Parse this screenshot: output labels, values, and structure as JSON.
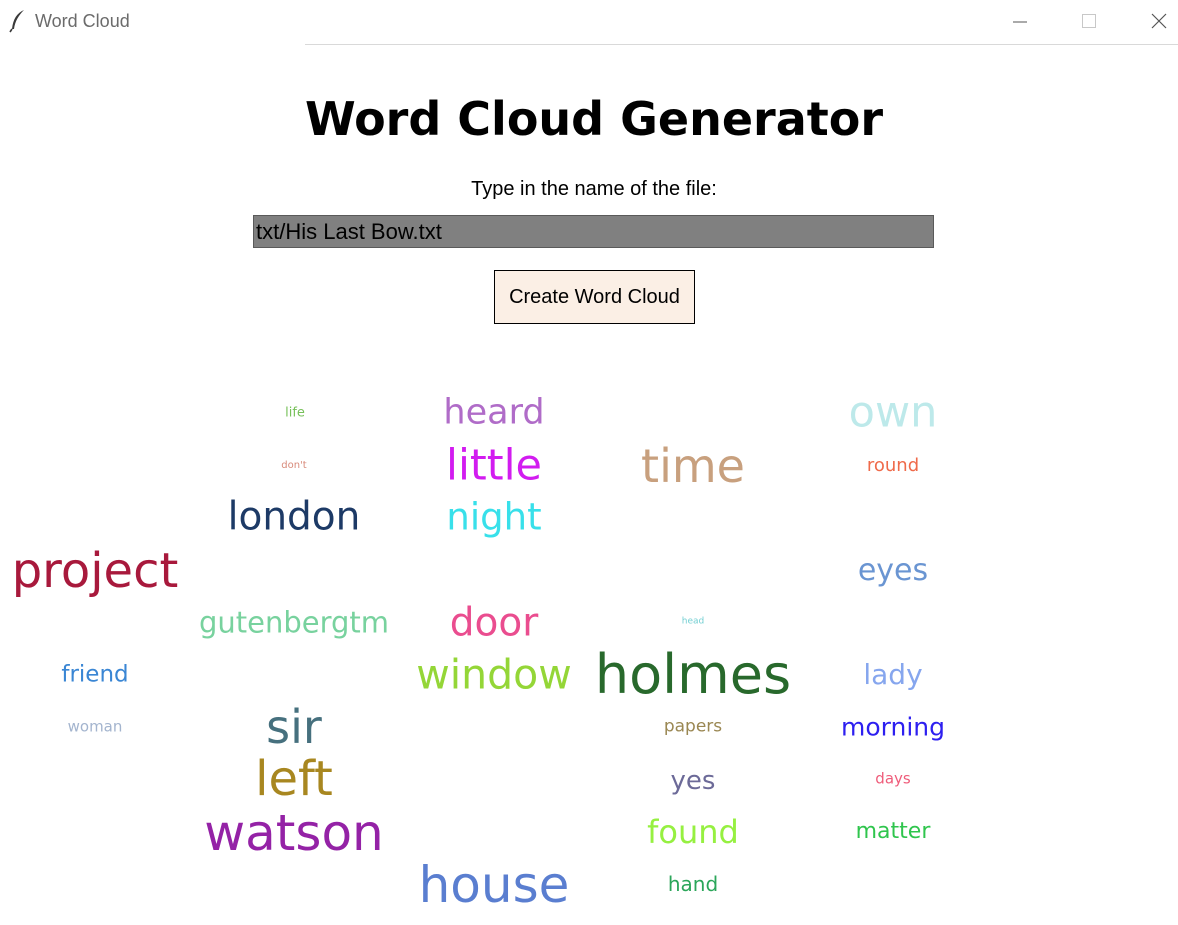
{
  "window": {
    "title": "Word Cloud"
  },
  "heading": "Word Cloud Generator",
  "prompt": "Type in the name of the file:",
  "file_input": {
    "value": "txt/His Last Bow.txt"
  },
  "create_button": {
    "label": "Create Word Cloud"
  },
  "cloud": {
    "words": {
      "life": {
        "text": "life",
        "color": "#77c05a"
      },
      "heard": {
        "text": "heard",
        "color": "#b06cc8"
      },
      "own": {
        "text": "own",
        "color": "#bde9ea"
      },
      "dont": {
        "text": "don't",
        "color": "#d88a7a"
      },
      "little": {
        "text": "little",
        "color": "#d21cf0"
      },
      "time": {
        "text": "time",
        "color": "#c8a07e"
      },
      "round": {
        "text": "round",
        "color": "#ef6a4a"
      },
      "london": {
        "text": "london",
        "color": "#1d3a66"
      },
      "night": {
        "text": "night",
        "color": "#38e0ea"
      },
      "project": {
        "text": "project",
        "color": "#a8193c"
      },
      "eyes": {
        "text": "eyes",
        "color": "#6a95d2"
      },
      "gutenbergtm": {
        "text": "gutenbergtm",
        "color": "#78d29e"
      },
      "door": {
        "text": "door",
        "color": "#ea4d8f"
      },
      "head": {
        "text": "head",
        "color": "#73cfd2"
      },
      "friend": {
        "text": "friend",
        "color": "#3a86d4"
      },
      "window": {
        "text": "window",
        "color": "#94d637"
      },
      "holmes": {
        "text": "holmes",
        "color": "#28692c"
      },
      "lady": {
        "text": "lady",
        "color": "#86a6ee"
      },
      "woman": {
        "text": "woman",
        "color": "#a3b4ce"
      },
      "sir": {
        "text": "sir",
        "color": "#46707e"
      },
      "papers": {
        "text": "papers",
        "color": "#9a8752"
      },
      "morning": {
        "text": "morning",
        "color": "#2d1ff0"
      },
      "left": {
        "text": "left",
        "color": "#a88720"
      },
      "yes": {
        "text": "yes",
        "color": "#6c6a98"
      },
      "days": {
        "text": "days",
        "color": "#ef5c7a"
      },
      "watson": {
        "text": "watson",
        "color": "#9422a6"
      },
      "found": {
        "text": "found",
        "color": "#96f041"
      },
      "matter": {
        "text": "matter",
        "color": "#2fc54d"
      },
      "house": {
        "text": "house",
        "color": "#5a7ed0"
      },
      "hand": {
        "text": "hand",
        "color": "#2ba65a"
      }
    }
  }
}
